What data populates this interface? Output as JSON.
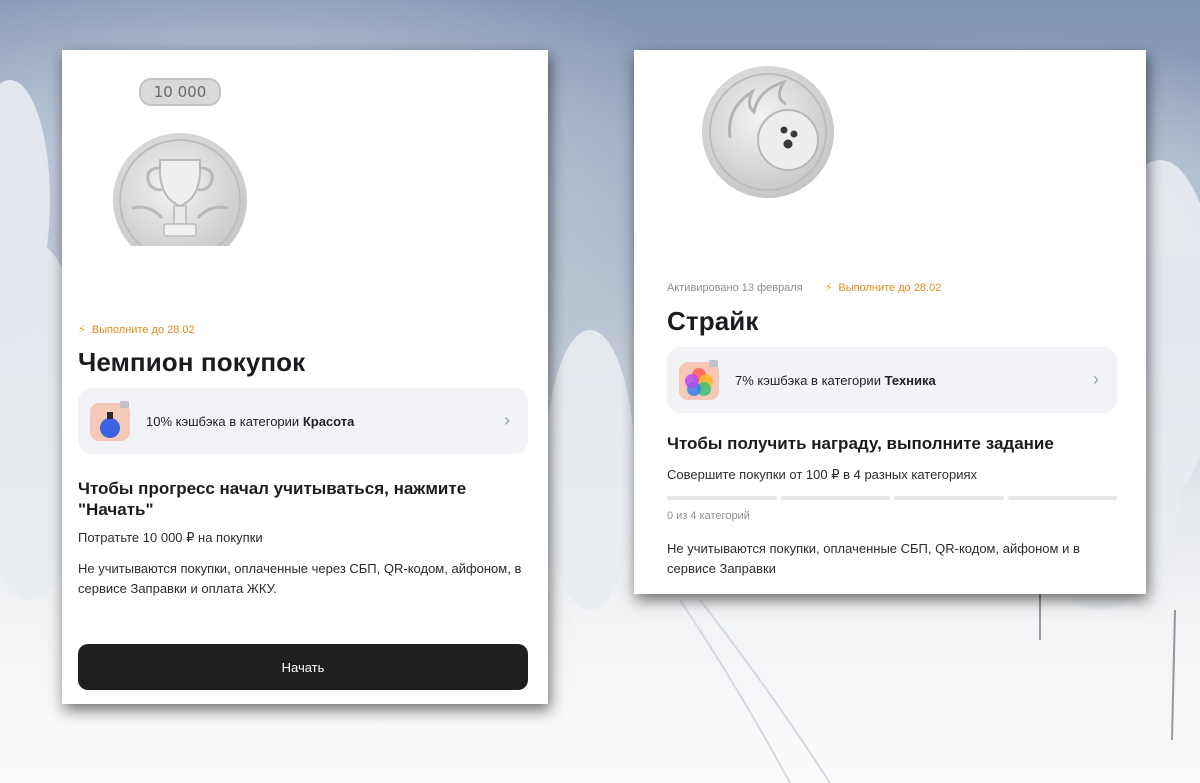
{
  "challenge_1": {
    "badge_value": "10 000",
    "deadline": "Выполните до 28.02",
    "title": "Чемпион покупок",
    "cashback": {
      "text_prefix": "10% кэшбэка в категории",
      "category": "Красота"
    },
    "instruction_title": "Чтобы прогресс начал учитываться, нажмите \"Начать\"",
    "task": "Потратьте 10 000 ₽ на покупки",
    "note": "Не учитываются покупки, оплаченные через СБП, QR-кодом, айфоном, в сервисе Заправки и оплата ЖКУ.",
    "start_button": "Начать"
  },
  "challenge_2": {
    "activated": "Активировано 13 февраля",
    "deadline": "Выполните до 28.02",
    "title": "Страйк",
    "cashback": {
      "text_prefix": "7% кэшбэка в категории",
      "category": "Техника"
    },
    "instruction_title": "Чтобы получить награду, выполните задание",
    "task": "Совершите покупки от 100 ₽ в 4 разных категориях",
    "progress": {
      "done": 0,
      "total": 4,
      "label": "0 из 4 категорий"
    },
    "note": "Не учитываются покупки, оплаченные СБП, QR-кодом, айфоном и в сервисе Заправки"
  },
  "colors": {
    "accent_orange": "#e08a1e",
    "button_dark": "#1f1f22",
    "panel_bg": "#f1f3f6"
  },
  "icons": [
    "trophy-medal-icon",
    "bowling-ball-medal-icon",
    "bolt-icon",
    "perfume-icon",
    "color-wheel-icon",
    "chevron-right-icon"
  ]
}
